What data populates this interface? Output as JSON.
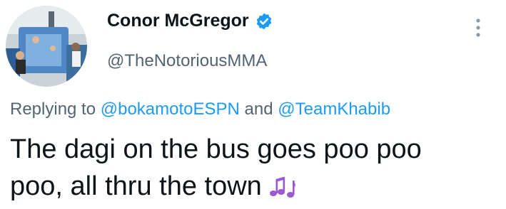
{
  "author": {
    "display_name": "Conor McGregor",
    "handle": "@TheNotoriousMMA",
    "verified": true
  },
  "reply": {
    "prefix": "Replying to",
    "mention_1": "@bokamotoESPN",
    "connector": "and",
    "mention_2": "@TeamKhabib"
  },
  "tweet": {
    "line_1": "The dagi on the bus goes poo poo",
    "line_2": "poo, all thru the town",
    "emoji": "musical-notes-emoji"
  },
  "icons": {
    "verified": "verified-badge-icon",
    "more": "more-options-icon"
  },
  "colors": {
    "text_primary": "#0f1419",
    "text_secondary": "#536471",
    "link": "#1d9bf0",
    "verified": "#1d9bf0",
    "emoji": "#9b59d0"
  }
}
